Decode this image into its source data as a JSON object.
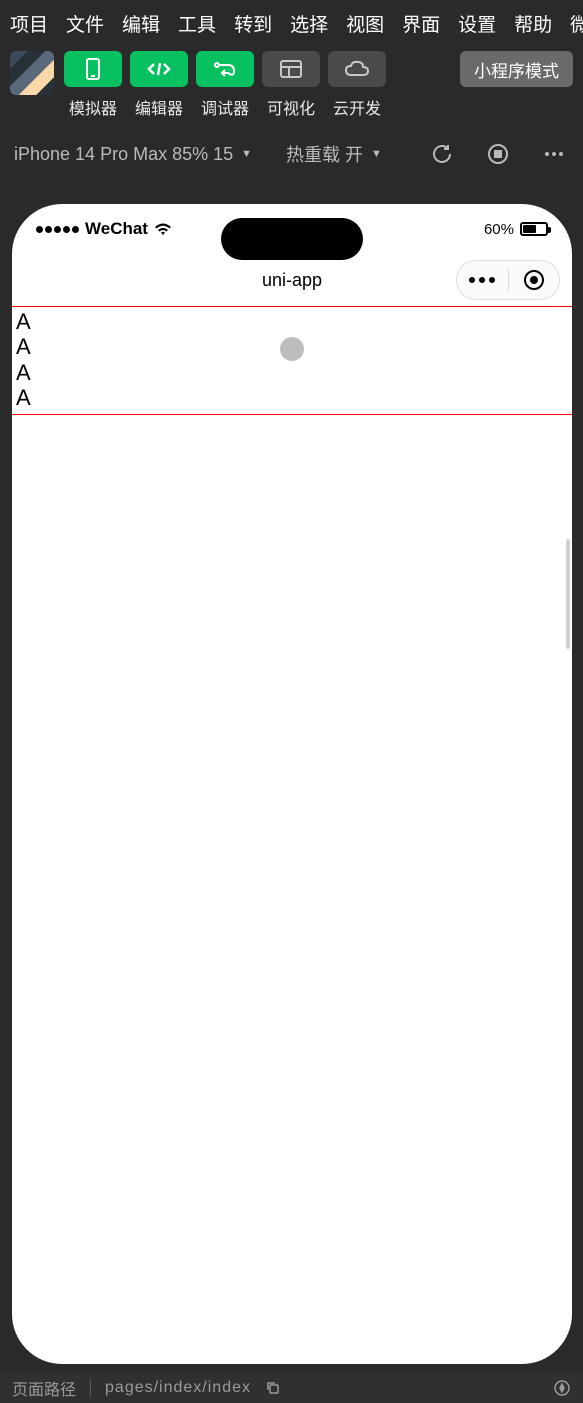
{
  "menu": [
    "项目",
    "文件",
    "编辑",
    "工具",
    "转到",
    "选择",
    "视图",
    "界面",
    "设置",
    "帮助",
    "微信"
  ],
  "toolbar": {
    "items": [
      {
        "label": "模拟器",
        "variant": "green",
        "icon": "phone"
      },
      {
        "label": "编辑器",
        "variant": "green",
        "icon": "code"
      },
      {
        "label": "调试器",
        "variant": "green",
        "icon": "route"
      },
      {
        "label": "可视化",
        "variant": "gray",
        "icon": "layout"
      },
      {
        "label": "云开发",
        "variant": "gray",
        "icon": "cloud"
      }
    ],
    "mode_btn": "小程序模式"
  },
  "device_row": {
    "device": "iPhone 14 Pro Max 85% 15",
    "hot_reload": "热重载 开"
  },
  "simulator": {
    "statusbar": {
      "carrier": "WeChat",
      "battery_pct": "60%"
    },
    "nav_title": "uni-app",
    "content_rows": [
      "A",
      "A",
      "A",
      "A"
    ]
  },
  "path_bar": {
    "label": "页面路径",
    "path": "pages/index/index"
  }
}
